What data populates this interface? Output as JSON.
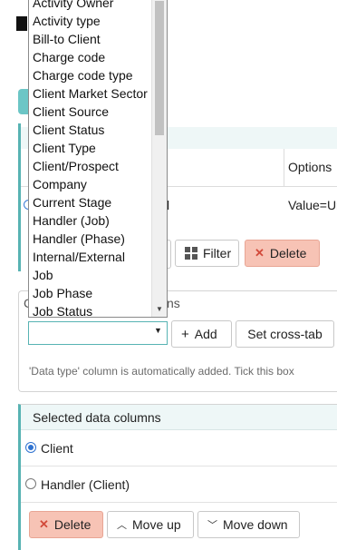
{
  "table": {
    "options_header": "Options",
    "row_name_fragment": "l",
    "row_value": "Value=Ur"
  },
  "toolbar": {
    "filter_label": "Filter",
    "delete_label": "Delete"
  },
  "columns_panel": {
    "legend_start": "C",
    "legend_end": "ns",
    "add_label": "Add",
    "crosstab_label": "Set cross-tab",
    "info_text": "'Data type' column is automatically added. Tick this box"
  },
  "dropdown": {
    "options": [
      "Activity Owner",
      "Activity type",
      "Bill-to Client",
      "Charge code",
      "Charge code type",
      "Client Market Sector",
      "Client Source",
      "Client Status",
      "Client Type",
      "Client/Prospect",
      "Company",
      "Current Stage",
      "Handler (Job)",
      "Handler (Phase)",
      "Internal/External",
      "Job",
      "Job Phase",
      "Job Status"
    ]
  },
  "selected_panel": {
    "title": "Selected data columns",
    "items": [
      {
        "label": "Client",
        "selected": true
      },
      {
        "label": "Handler (Client)",
        "selected": false
      }
    ],
    "delete_label": "Delete",
    "move_up_label": "Move up",
    "move_down_label": "Move down"
  },
  "colors": {
    "accent_teal": "#57b3b3",
    "danger_bg": "#f7c3b5",
    "danger_icon": "#d24a3a"
  },
  "icons": {
    "filter": "filter-icon",
    "delete": "close-icon",
    "add": "plus-icon",
    "move_up": "chevron-up-icon",
    "move_down": "chevron-down-icon"
  }
}
